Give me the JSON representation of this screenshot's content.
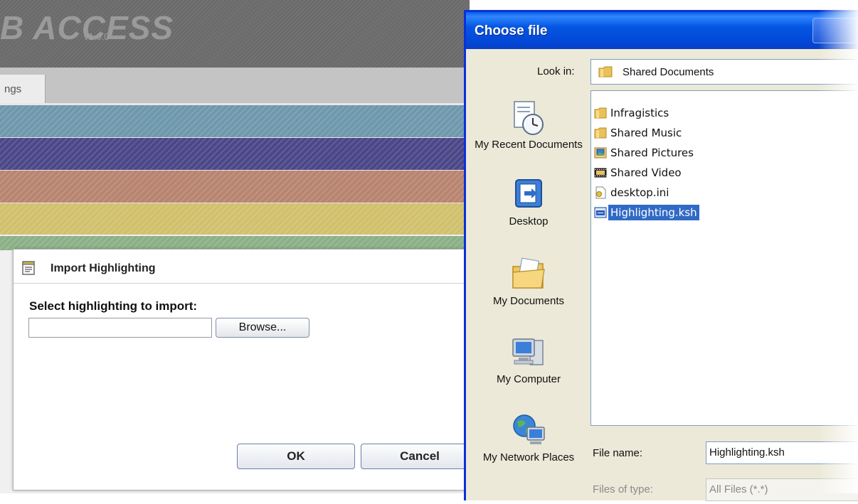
{
  "background_app": {
    "logo": "B ACCESS",
    "version": "v1.0.0",
    "tab_partial": "ngs",
    "stripes": [
      "#6f98ad",
      "#4b4788",
      "#b88470",
      "#d1c06c",
      "#8bb087"
    ]
  },
  "import_dialog": {
    "title": "Import Highlighting",
    "prompt": "Select highlighting to import:",
    "file_value": "",
    "browse_label": "Browse...",
    "ok_label": "OK",
    "cancel_label": "Cancel"
  },
  "choose_file": {
    "title": "Choose file",
    "look_in_label": "Look in:",
    "look_in_value": "Shared Documents",
    "places": [
      {
        "label": "My Recent Documents",
        "icon": "recent-documents-icon"
      },
      {
        "label": "Desktop",
        "icon": "desktop-icon"
      },
      {
        "label": "My Documents",
        "icon": "my-documents-icon"
      },
      {
        "label": "My Computer",
        "icon": "my-computer-icon"
      },
      {
        "label": "My Network Places",
        "icon": "network-places-icon"
      }
    ],
    "files": [
      {
        "name": "Infragistics",
        "icon": "folder-icon"
      },
      {
        "name": "Shared Music",
        "icon": "folder-icon"
      },
      {
        "name": "Shared Pictures",
        "icon": "pictures-folder-icon"
      },
      {
        "name": "Shared Video",
        "icon": "video-folder-icon"
      },
      {
        "name": "desktop.ini",
        "icon": "ini-file-icon"
      },
      {
        "name": "Highlighting.ksh",
        "icon": "ksh-file-icon",
        "selected": true
      }
    ],
    "file_name_label": "File name:",
    "file_name_value": "Highlighting.ksh",
    "files_of_type_label": "Files of type:",
    "files_of_type_value": "All Files (*.*)",
    "colors": {
      "titlebar": "#0453dc",
      "selection": "#316ac5",
      "face": "#ece9d8"
    }
  }
}
